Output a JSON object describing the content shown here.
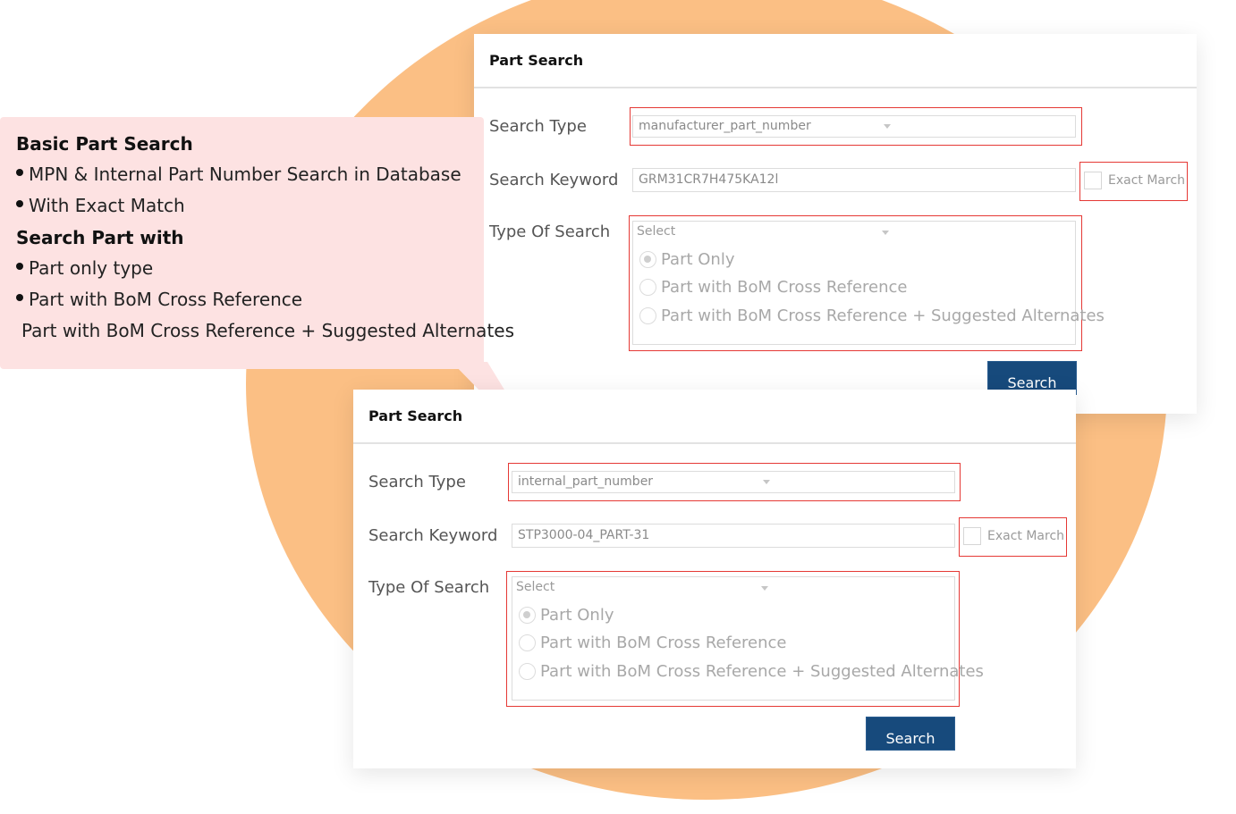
{
  "colors": {
    "accent_circle": "#fbbf84",
    "callout_bg": "#fde2e2",
    "highlight_border": "#e53935",
    "button_bg": "#174a7c"
  },
  "callout": {
    "sections": [
      {
        "heading": "Basic Part Search",
        "bullets": [
          "MPN & Internal Part Number Search in Database",
          "With Exact Match"
        ]
      },
      {
        "heading": "Search Part with",
        "bullets": [
          "Part only type",
          "Part with BoM Cross Reference",
          "Part with BoM Cross Reference + Suggested Alternates"
        ]
      }
    ]
  },
  "panels": [
    {
      "title": "Part Search",
      "search_type_label": "Search Type",
      "search_type_value": "manufacturer_part_number",
      "keyword_label": "Search Keyword",
      "keyword_value": "GRM31CR7H475KA12l",
      "exact_match_label": "Exact March",
      "exact_match_checked": false,
      "type_of_search_label": "Type Of Search",
      "type_of_search_placeholder": "Select",
      "options": [
        {
          "label": "Part Only",
          "selected": true
        },
        {
          "label": "Part with BoM Cross Reference",
          "selected": false
        },
        {
          "label": "Part with BoM Cross Reference + Suggested Alternates",
          "selected": false
        }
      ],
      "search_button": "Search"
    },
    {
      "title": "Part Search",
      "search_type_label": "Search Type",
      "search_type_value": "internal_part_number",
      "keyword_label": "Search Keyword",
      "keyword_value": "STP3000-04_PART-31",
      "exact_match_label": "Exact March",
      "exact_match_checked": false,
      "type_of_search_label": "Type Of Search",
      "type_of_search_placeholder": "Select",
      "options": [
        {
          "label": "Part Only",
          "selected": true
        },
        {
          "label": "Part with BoM Cross Reference",
          "selected": false
        },
        {
          "label": "Part with BoM Cross Reference + Suggested Alternates",
          "selected": false
        }
      ],
      "search_button": "Search"
    }
  ]
}
